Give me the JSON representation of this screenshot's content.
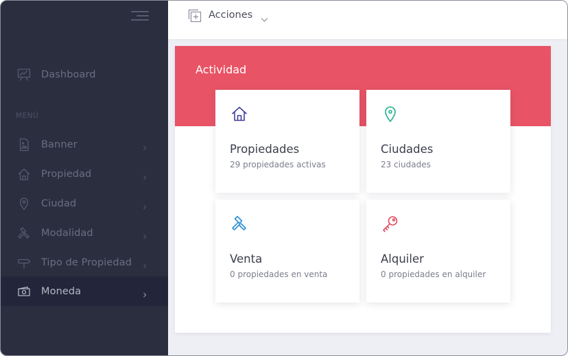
{
  "sidebar": {
    "section_label": "MENÚ",
    "dashboard": {
      "label": "Dashboard",
      "icon": "presentation-chart-icon"
    },
    "items": [
      {
        "label": "Banner",
        "icon": "image-file-icon"
      },
      {
        "label": "Propiedad",
        "icon": "house-icon"
      },
      {
        "label": "Ciudad",
        "icon": "map-pin-icon"
      },
      {
        "label": "Modalidad",
        "icon": "gavel-icon"
      },
      {
        "label": "Tipo de Propiedad",
        "icon": "signpost-icon"
      },
      {
        "label": "Moneda",
        "icon": "cash-icon"
      }
    ]
  },
  "topbar": {
    "label": "Acciones",
    "icon": "add-square-icon"
  },
  "panel": {
    "title": "Actividad",
    "cards": [
      {
        "title": "Propiedades",
        "subtitle": "29 propiedades activas",
        "icon": "house-icon",
        "color": "#3f3f9a"
      },
      {
        "title": "Ciudades",
        "subtitle": "23 ciudades",
        "icon": "map-pin-icon",
        "color": "#1fae8c"
      },
      {
        "title": "Venta",
        "subtitle": "0 propiedades en venta",
        "icon": "gavel-icon",
        "color": "#2d8fd8"
      },
      {
        "title": "Alquiler",
        "subtitle": "0 propiedades en alquiler",
        "icon": "key-icon",
        "color": "#e34a5d"
      }
    ]
  },
  "colors": {
    "sidebar_bg": "#2b2e3f",
    "accent_band": "#e85465",
    "page_bg": "#eeeff5"
  }
}
